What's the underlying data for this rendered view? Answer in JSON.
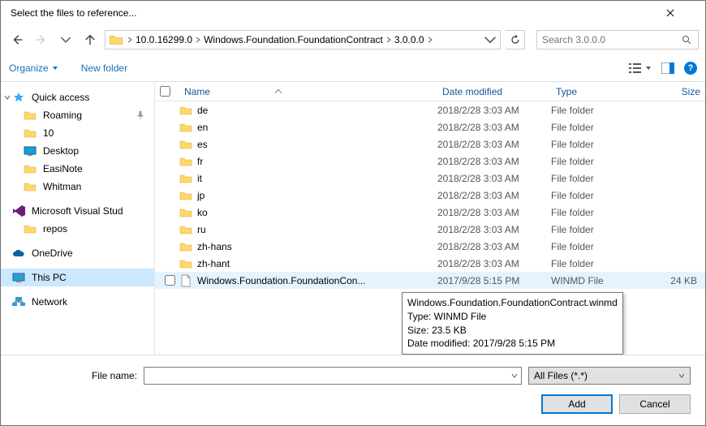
{
  "title": "Select the files to reference...",
  "breadcrumb": {
    "segments": [
      "10.0.16299.0",
      "Windows.Foundation.FoundationContract",
      "3.0.0.0"
    ]
  },
  "search": {
    "placeholder": "Search 3.0.0.0"
  },
  "toolbar": {
    "organize": "Organize",
    "newfolder": "New folder"
  },
  "nav": {
    "quick_access": "Quick access",
    "roaming": "Roaming",
    "ten": "10",
    "desktop": "Desktop",
    "easinote": "EasiNote",
    "whitman": "Whitman",
    "vs": "Microsoft Visual Stud",
    "repos": "repos",
    "onedrive": "OneDrive",
    "thispc": "This PC",
    "network": "Network"
  },
  "columns": {
    "name": "Name",
    "date": "Date modified",
    "type": "Type",
    "size": "Size"
  },
  "files": [
    {
      "name": "de",
      "date": "2018/2/28 3:03 AM",
      "type": "File folder",
      "size": "",
      "icon": "folder"
    },
    {
      "name": "en",
      "date": "2018/2/28 3:03 AM",
      "type": "File folder",
      "size": "",
      "icon": "folder"
    },
    {
      "name": "es",
      "date": "2018/2/28 3:03 AM",
      "type": "File folder",
      "size": "",
      "icon": "folder"
    },
    {
      "name": "fr",
      "date": "2018/2/28 3:03 AM",
      "type": "File folder",
      "size": "",
      "icon": "folder"
    },
    {
      "name": "it",
      "date": "2018/2/28 3:03 AM",
      "type": "File folder",
      "size": "",
      "icon": "folder"
    },
    {
      "name": "jp",
      "date": "2018/2/28 3:03 AM",
      "type": "File folder",
      "size": "",
      "icon": "folder"
    },
    {
      "name": "ko",
      "date": "2018/2/28 3:03 AM",
      "type": "File folder",
      "size": "",
      "icon": "folder"
    },
    {
      "name": "ru",
      "date": "2018/2/28 3:03 AM",
      "type": "File folder",
      "size": "",
      "icon": "folder"
    },
    {
      "name": "zh-hans",
      "date": "2018/2/28 3:03 AM",
      "type": "File folder",
      "size": "",
      "icon": "folder"
    },
    {
      "name": "zh-hant",
      "date": "2018/2/28 3:03 AM",
      "type": "File folder",
      "size": "",
      "icon": "folder"
    },
    {
      "name": "Windows.Foundation.FoundationCon...",
      "date": "2017/9/28 5:15 PM",
      "type": "WINMD File",
      "size": "24 KB",
      "icon": "file",
      "hover": true
    }
  ],
  "tooltip": {
    "line1": "Windows.Foundation.FoundationContract.winmd",
    "line2": "Type: WINMD File",
    "line3": "Size: 23.5 KB",
    "line4": "Date modified: 2017/9/28 5:15 PM"
  },
  "footer": {
    "filename_label": "File name:",
    "filter": "All Files (*.*)",
    "add": "Add",
    "cancel": "Cancel"
  }
}
